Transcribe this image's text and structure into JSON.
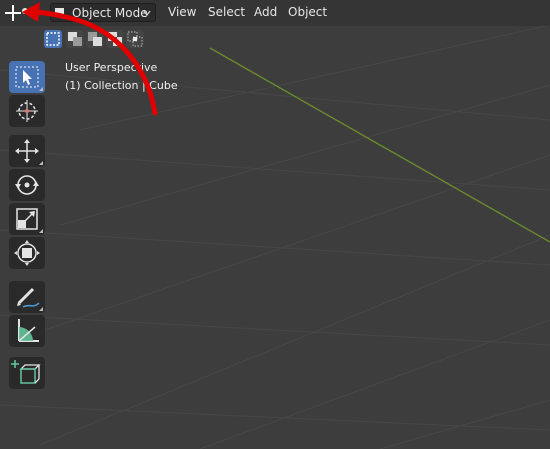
{
  "header": {
    "mode_label": "Object Mode",
    "menus": [
      "View",
      "Select",
      "Add",
      "Object"
    ]
  },
  "viewport": {
    "perspective_label": "User Perspective",
    "collection_label": "(1) Collection | Cube"
  },
  "toolbar": {
    "tools": [
      "select-box",
      "cursor",
      "move",
      "rotate",
      "scale",
      "transform",
      "annotate",
      "measure",
      "add-cube"
    ],
    "active_tool": "select-box"
  },
  "selection_modes": [
    "set",
    "extend",
    "subtract",
    "difference",
    "intersect"
  ],
  "colors": {
    "viewport_bg": "#3d3d3d",
    "grid_line": "#484848",
    "x_axis": "#6a8a2c",
    "active_tool": "#4772b3",
    "annotation_arrow": "#e00000"
  }
}
